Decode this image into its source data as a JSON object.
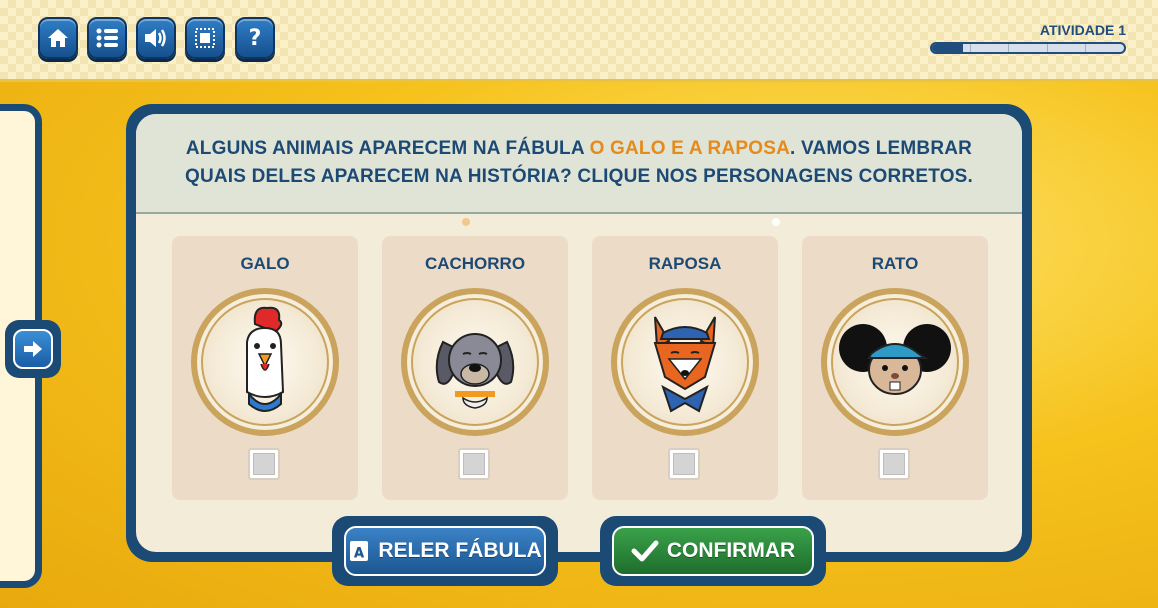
{
  "toolbar": {
    "buttons": [
      {
        "name": "home",
        "icon": "home-icon"
      },
      {
        "name": "menu",
        "icon": "list-icon"
      },
      {
        "name": "sound",
        "icon": "speaker-icon"
      },
      {
        "name": "fullscreen",
        "icon": "fullscreen-icon"
      },
      {
        "name": "help",
        "icon": "question-icon",
        "glyph": "?"
      }
    ]
  },
  "activity": {
    "label": "ATIVIDADE 1",
    "progress": 0.16,
    "segments": 6
  },
  "instruction": {
    "part1": "ALGUNS ANIMAIS APARECEM NA FÁBULA ",
    "highlight": "O GALO E A RAPOSA",
    "part2": ". VAMOS LEMBRAR QUAIS DELES APARECEM NA HISTÓRIA? CLIQUE NOS PERSONAGENS CORRETOS."
  },
  "options": [
    {
      "label": "GALO",
      "icon": "rooster-icon",
      "checked": false
    },
    {
      "label": "CACHORRO",
      "icon": "dog-icon",
      "checked": false
    },
    {
      "label": "RAPOSA",
      "icon": "fox-icon",
      "checked": false
    },
    {
      "label": "RATO",
      "icon": "mouse-icon",
      "checked": false
    }
  ],
  "actions": {
    "reread_label": "RELER FÁBULA",
    "confirm_label": "CONFIRMAR"
  },
  "colors": {
    "navy": "#1b4a74",
    "highlight": "#e58a1b",
    "confirm": "#2e8a3c"
  }
}
